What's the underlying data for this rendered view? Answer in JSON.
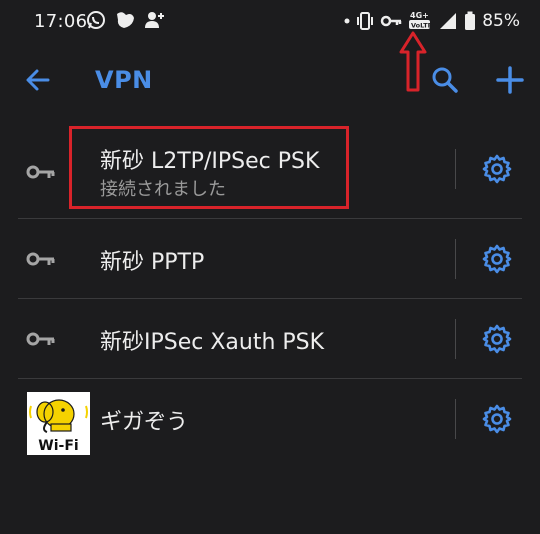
{
  "status_bar": {
    "time": "17:06",
    "battery": "85%",
    "network": "4G+",
    "icons_left": [
      "whatsapp-icon",
      "bird-icon",
      "add-person-icon"
    ],
    "icons_right": [
      "dot-icon",
      "vibrate-icon",
      "vpn-key-icon",
      "lte-icon",
      "signal-icon",
      "battery-icon"
    ]
  },
  "toolbar": {
    "title": "VPN",
    "accent": "#4a8de6"
  },
  "vpn_list": [
    {
      "name": "新砂 L2TP/IPSec PSK",
      "status": "接続されました",
      "icon": "key-icon"
    },
    {
      "name": "新砂 PPTP",
      "status": "",
      "icon": "key-icon"
    },
    {
      "name": "新砂IPSec Xauth PSK",
      "status": "",
      "icon": "key-icon"
    },
    {
      "name": "ギガぞう",
      "status": "",
      "icon": "wifi-logo",
      "logo_text": "Wi-Fi"
    }
  ],
  "annotation_color": "#d8232a"
}
